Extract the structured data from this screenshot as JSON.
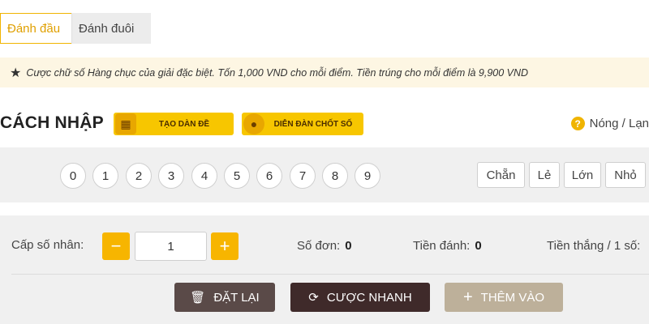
{
  "tabs": [
    {
      "label": "Đánh đầu",
      "active": true
    },
    {
      "label": "Đánh đuôi",
      "active": false
    }
  ],
  "notice": {
    "icon": "star-icon",
    "text": "Cược chữ số Hàng chục của giải đặc biệt. Tốn 1,000 VND cho mỗi điểm. Tiền trúng cho mỗi điểm là 9,900 VND"
  },
  "howto": {
    "title": "CÁCH NHẬP",
    "create_set_label": "TẠO DÀN ĐỀ",
    "forum_label": "DIỄN ĐÀN CHỐT SỐ",
    "hot_cold_label": "Nóng / Lạn"
  },
  "digits": [
    "0",
    "1",
    "2",
    "3",
    "4",
    "5",
    "6",
    "7",
    "8",
    "9"
  ],
  "filters": [
    "Chẵn",
    "Lẻ",
    "Lớn",
    "Nhỏ"
  ],
  "bet": {
    "multiplier_label": "Cấp số nhân:",
    "multiplier_value": "1",
    "orders_label": "Số đơn:",
    "orders_value": "0",
    "amount_label": "Tiền đánh:",
    "amount_value": "0",
    "win_label": "Tiền thắng / 1 số:"
  },
  "actions": {
    "reset_label": "ĐẶT LẠI",
    "quick_bet_label": "CƯỢC NHANH",
    "add_label": "THÊM VÀO"
  },
  "colors": {
    "accent": "#f7b500",
    "reset_bg": "#5a4a48",
    "quick_bet_bg": "#3f2a2a",
    "add_bg": "#bdb09a"
  }
}
